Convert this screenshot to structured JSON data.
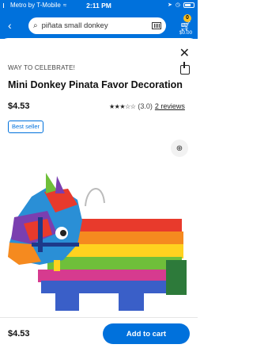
{
  "status_bar": {
    "carrier": "Metro by T-Mobile",
    "time": "2:11 PM"
  },
  "header": {
    "search_query": "piñata small donkey",
    "cart_count": "0",
    "cart_total": "$0.00",
    "back_icon": "chevron-left-icon",
    "search_icon": "search-icon",
    "barcode_icon": "barcode-icon",
    "cart_icon": "cart-icon"
  },
  "product": {
    "brand": "WAY TO CELEBRATE!",
    "title": "Mini Donkey Pinata Favor Decoration",
    "price": "$4.53",
    "rating": "(3.0)",
    "reviews": "2 reviews",
    "stars_filled": 3,
    "stars_total": 5,
    "badge": "Best seller"
  },
  "bottom_bar": {
    "price": "$4.53",
    "add_to_cart": "Add to cart"
  },
  "colors": {
    "brand_blue": "#0071dc",
    "cart_badge": "#ffc220"
  }
}
